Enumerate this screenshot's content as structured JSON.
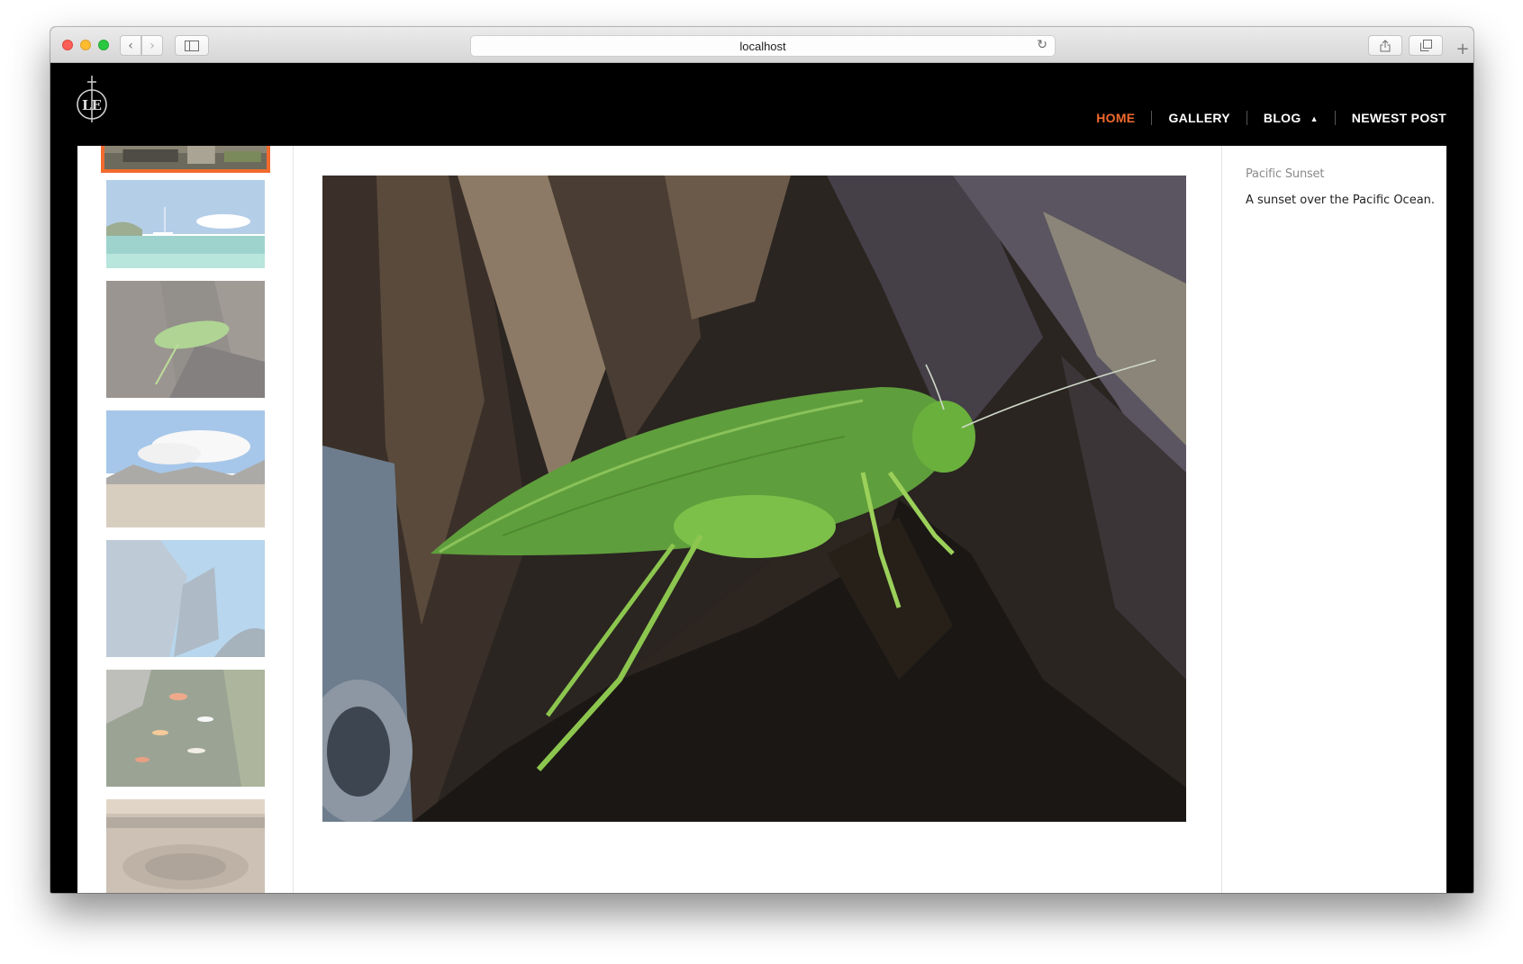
{
  "browser": {
    "url": "localhost",
    "icons": {
      "back": "chevron-left-icon",
      "forward": "chevron-right-icon",
      "sidebar": "sidebar-icon",
      "reload": "reload-icon",
      "share": "share-icon",
      "tabs": "tabs-icon",
      "new_tab": "plus-icon"
    }
  },
  "site": {
    "logo_text": "LE",
    "nav": [
      {
        "label": "HOME",
        "active": true
      },
      {
        "label": "GALLERY",
        "active": false
      },
      {
        "label": "BLOG",
        "active": false,
        "has_dropdown": true
      },
      {
        "label": "NEWEST POST",
        "active": false
      }
    ],
    "accent_color": "#f26a2e"
  },
  "gallery": {
    "thumbnails": [
      {
        "subject": "harbor",
        "selected": true
      },
      {
        "subject": "sea-with-boat",
        "selected": false
      },
      {
        "subject": "katydid-on-stump",
        "selected": false
      },
      {
        "subject": "desert-mountains",
        "selected": false
      },
      {
        "subject": "curved-architecture",
        "selected": false
      },
      {
        "subject": "koi-pond",
        "selected": false
      },
      {
        "subject": "colosseum",
        "selected": false
      }
    ],
    "main_image": "katydid-on-stump"
  },
  "info": {
    "title": "Pacific Sunset",
    "description": "A sunset over the Pacific Ocean."
  }
}
